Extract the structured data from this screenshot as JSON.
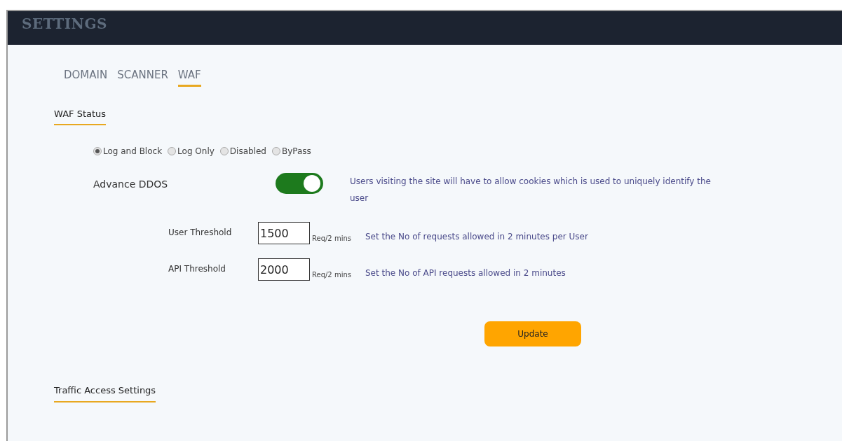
{
  "header": {
    "title": "SETTINGS"
  },
  "tabs": [
    {
      "label": "DOMAIN",
      "selected": false
    },
    {
      "label": "SCANNER",
      "selected": false
    },
    {
      "label": "WAF",
      "selected": true
    }
  ],
  "waf_status": {
    "heading": "WAF Status",
    "options": [
      {
        "label": "Log and Block",
        "selected": true
      },
      {
        "label": "Log Only",
        "selected": false
      },
      {
        "label": "Disabled",
        "selected": false
      },
      {
        "label": "ByPass",
        "selected": false
      }
    ]
  },
  "advance_ddos": {
    "label": "Advance DDOS",
    "on": true,
    "description": "Users visiting the site will have to allow cookies which is used to uniquely identify the user"
  },
  "thresholds": [
    {
      "label": "User Threshold",
      "value": "1500",
      "unit": "Req/2 mins",
      "description": "Set the No of requests allowed in 2 minutes per User"
    },
    {
      "label": "API Threshold",
      "value": "2000",
      "unit": "Req/2 mins",
      "description": "Set the No of API requests allowed in 2 minutes"
    }
  ],
  "update_button": "Update",
  "traffic_heading": "Traffic Access Settings"
}
